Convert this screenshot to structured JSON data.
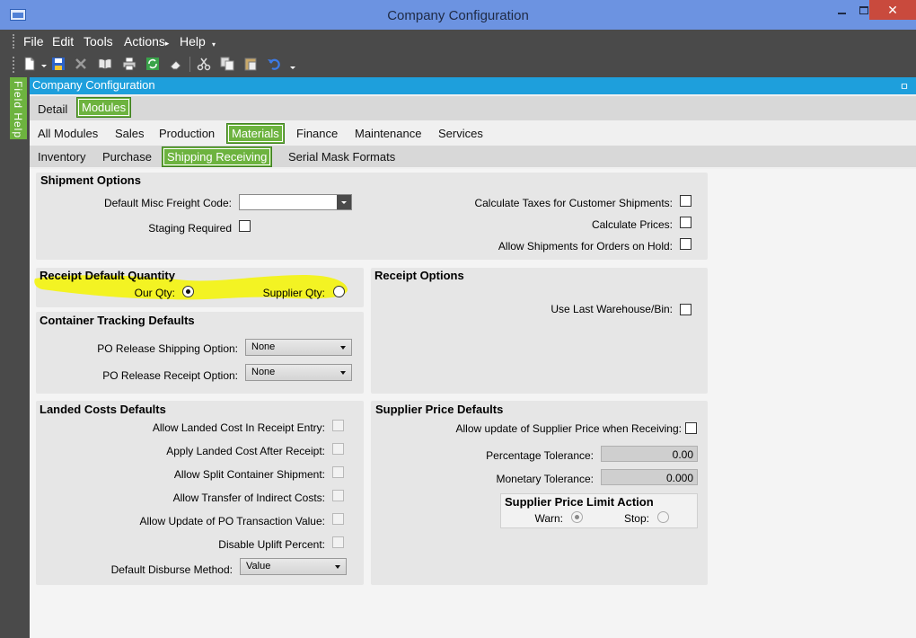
{
  "window": {
    "title": "Company Configuration",
    "close_glyph": "✕"
  },
  "menu": {
    "file": "File",
    "edit": "Edit",
    "tools": "Tools",
    "actions": "Actions",
    "actions_arrow": "▸",
    "help": "Help",
    "more": "▾"
  },
  "toolbar": {
    "icons": [
      "new-icon",
      "save-icon",
      "delete-icon",
      "book-icon",
      "print-icon",
      "refresh-icon",
      "eraser-icon",
      "cut-icon",
      "copy-icon",
      "paste-icon",
      "undo-icon"
    ]
  },
  "field_help": "Field Help",
  "panel": {
    "title": "Company Configuration",
    "pin_glyph": "ㅁ"
  },
  "tabs_level1": {
    "detail": "Detail",
    "modules": "Modules"
  },
  "tabs_level2": {
    "all_modules": "All Modules",
    "sales": "Sales",
    "production": "Production",
    "materials": "Materials",
    "finance": "Finance",
    "maintenance": "Maintenance",
    "services": "Services"
  },
  "tabs_level3": {
    "inventory": "Inventory",
    "purchase": "Purchase",
    "shipping_receiving": "Shipping Receiving",
    "serial_mask": "Serial Mask Formats"
  },
  "shipment_options": {
    "title": "Shipment Options",
    "misc_freight_label": "Default Misc Freight Code:",
    "misc_freight_value": "",
    "staging_label": "Staging Required",
    "calc_taxes_label": "Calculate Taxes for Customer Shipments:",
    "calc_prices_label": "Calculate Prices:",
    "allow_hold_label": "Allow Shipments for Orders on Hold:"
  },
  "receipt_default_qty": {
    "title": "Receipt Default Quantity",
    "our_qty_label": "Our Qty:",
    "supplier_qty_label": "Supplier Qty:",
    "selected": "our_qty"
  },
  "receipt_options": {
    "title": "Receipt Options",
    "use_last_label": "Use Last Warehouse/Bin:"
  },
  "container_tracking": {
    "title": "Container Tracking Defaults",
    "po_ship_label": "PO Release Shipping Option:",
    "po_ship_value": "None",
    "po_receipt_label": "PO Release Receipt Option:",
    "po_receipt_value": "None"
  },
  "landed_costs": {
    "title": "Landed Costs Defaults",
    "allow_entry_label": "Allow Landed Cost In Receipt Entry:",
    "apply_after_label": "Apply Landed Cost After Receipt:",
    "split_label": "Allow Split Container Shipment:",
    "transfer_label": "Allow Transfer of Indirect Costs:",
    "update_po_label": "Allow Update of PO Transaction Value:",
    "disable_uplift_label": "Disable Uplift Percent:",
    "disburse_label": "Default Disburse Method:",
    "disburse_value": "Value"
  },
  "supplier_price": {
    "title": "Supplier Price Defaults",
    "allow_update_label": "Allow update of Supplier Price when Receiving:",
    "pct_label": "Percentage Tolerance:",
    "pct_value": "0.00",
    "monetary_label": "Monetary Tolerance:",
    "monetary_value": "0.000",
    "limit_title": "Supplier Price Limit Action",
    "warn_label": "Warn:",
    "stop_label": "Stop:",
    "selected": "warn"
  },
  "colors": {
    "accent_green": "#6db33f",
    "header_blue": "#1e9fdc",
    "titlebar": "#6c93e1",
    "highlight": "#f5f500"
  }
}
